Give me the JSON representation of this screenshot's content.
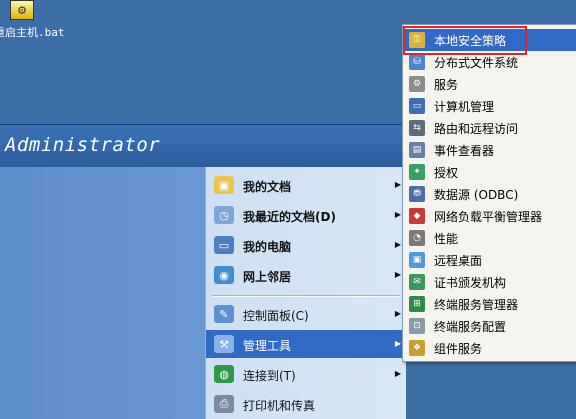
{
  "desktop": {
    "icon_label": "重启主机.bat"
  },
  "start_menu": {
    "user_name": "Administrator",
    "right_items": [
      {
        "label": "我的文档",
        "icon": "my-documents-icon",
        "bold": true,
        "arrow": true
      },
      {
        "label": "我最近的文档(D)",
        "icon": "recent-documents-icon",
        "bold": true,
        "arrow": true
      },
      {
        "label": "我的电脑",
        "icon": "my-computer-icon",
        "bold": true,
        "arrow": true
      },
      {
        "label": "网上邻居",
        "icon": "network-places-icon",
        "bold": true,
        "arrow": true
      },
      {
        "label": "控制面板(C)",
        "icon": "control-panel-icon",
        "bold": false,
        "arrow": true
      },
      {
        "label": "管理工具",
        "icon": "admin-tools-icon",
        "bold": false,
        "arrow": true,
        "selected": true
      },
      {
        "label": "连接到(T)",
        "icon": "connect-to-icon",
        "bold": false,
        "arrow": true
      },
      {
        "label": "打印机和传真",
        "icon": "printer-icon",
        "bold": false,
        "arrow": false
      }
    ]
  },
  "admin_tools_menu": {
    "items": [
      {
        "label": "本地安全策略",
        "icon": "security-policy-icon",
        "selected": true
      },
      {
        "label": "分布式文件系统",
        "icon": "dfs-icon"
      },
      {
        "label": "服务",
        "icon": "services-gear-icon"
      },
      {
        "label": "计算机管理",
        "icon": "computer-management-icon"
      },
      {
        "label": "路由和远程访问",
        "icon": "routing-icon"
      },
      {
        "label": "事件查看器",
        "icon": "event-viewer-icon"
      },
      {
        "label": "授权",
        "icon": "licensing-icon"
      },
      {
        "label": "数据源 (ODBC)",
        "icon": "odbc-icon"
      },
      {
        "label": "网络负载平衡管理器",
        "icon": "nlb-icon"
      },
      {
        "label": "性能",
        "icon": "performance-icon"
      },
      {
        "label": "远程桌面",
        "icon": "remote-desktop-icon"
      },
      {
        "label": "证书颁发机构",
        "icon": "certificate-icon"
      },
      {
        "label": "终端服务管理器",
        "icon": "terminal-services-manager-icon"
      },
      {
        "label": "终端服务配置",
        "icon": "terminal-services-config-icon"
      },
      {
        "label": "组件服务",
        "icon": "component-services-icon"
      }
    ]
  },
  "colors": {
    "desktop": "#3a6ea5",
    "selection": "#316ac5",
    "annotation": "#e0262b"
  }
}
